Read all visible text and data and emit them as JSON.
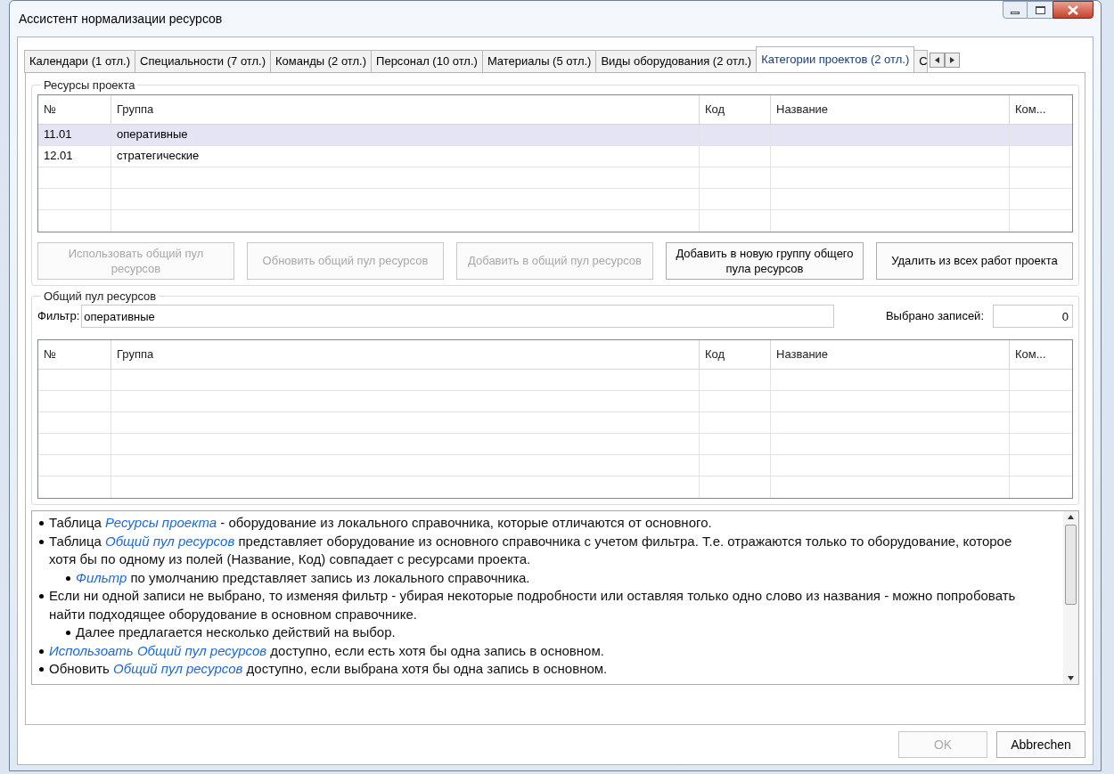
{
  "window": {
    "title": "Ассистент нормализации ресурсов"
  },
  "tabs": [
    {
      "label": "Календари (1 отл.)",
      "selected": false
    },
    {
      "label": "Специальности (7 отл.)",
      "selected": false
    },
    {
      "label": "Команды (2 отл.)",
      "selected": false
    },
    {
      "label": "Персонал (10 отл.)",
      "selected": false
    },
    {
      "label": "Материалы (5 отл.)",
      "selected": false
    },
    {
      "label": "Виды оборудования (2 отл.)",
      "selected": false
    },
    {
      "label": "Категории проектов (2 отл.)",
      "selected": true
    },
    {
      "label": "С",
      "selected": false
    }
  ],
  "project_resources": {
    "title": "Ресурсы проекта",
    "columns": [
      "№",
      "Группа",
      "Код",
      "Название",
      "Ком..."
    ],
    "rows": [
      {
        "cells": [
          "11.01",
          "оперативные",
          "",
          "",
          ""
        ],
        "selected": true
      },
      {
        "cells": [
          "12.01",
          "стратегические",
          "",
          "",
          ""
        ],
        "selected": false
      }
    ],
    "buttons": [
      {
        "label": "Использовать общий пул ресурсов",
        "disabled": true
      },
      {
        "label": "Обновить общий пул ресурсов",
        "disabled": true
      },
      {
        "label": "Добавить в общий пул ресурсов",
        "disabled": true
      },
      {
        "label": "Добавить в новую группу общего пула ресурсов",
        "disabled": false
      },
      {
        "label": "Удалить из всех работ проекта",
        "disabled": false
      }
    ]
  },
  "shared_pool": {
    "title": "Общий пул ресурсов",
    "filter_label": "Фильтр:",
    "filter_value": "оперативные",
    "selected_label": "Выбрано записей:",
    "selected_value": "0",
    "columns": [
      "№",
      "Группа",
      "Код",
      "Название",
      "Ком..."
    ]
  },
  "help": [
    {
      "text": "Таблица *Ресурсы проекта* - оборудование из локального справочника, которые отличаются от основного."
    },
    {
      "text": "Таблица *Общий пул ресурсов* представляет оборудование из основного справочника с учетом фильтра. Т.е. отражаются только то оборудование, которое хотя бы по одному из полей (Название, Код) совпадает с ресурсами проекта.",
      "children": [
        {
          "text": "*Фильтр* по умолчанию представляет запись из локального справочника."
        }
      ]
    },
    {
      "text": "Если ни одной записи не выбрано, то изменяя фильтр - убирая некоторые подробности или оставляя только одно слово из названия - можно попробовать найти подходящее оборудование в основном справочнике.",
      "children": [
        {
          "text": "Далее предлагается несколько действий на выбор."
        }
      ]
    },
    {
      "text": "*Использоать Общий пул ресурсов* доступно, если есть хотя бы одна запись в основном."
    },
    {
      "text": "Обновить *Общий пул ресурсов* доступно, если выбрана хотя бы одна запись в основном."
    }
  ],
  "footer": [
    {
      "label": "OK",
      "disabled": true
    },
    {
      "label": "Abbrechen",
      "disabled": false
    }
  ]
}
